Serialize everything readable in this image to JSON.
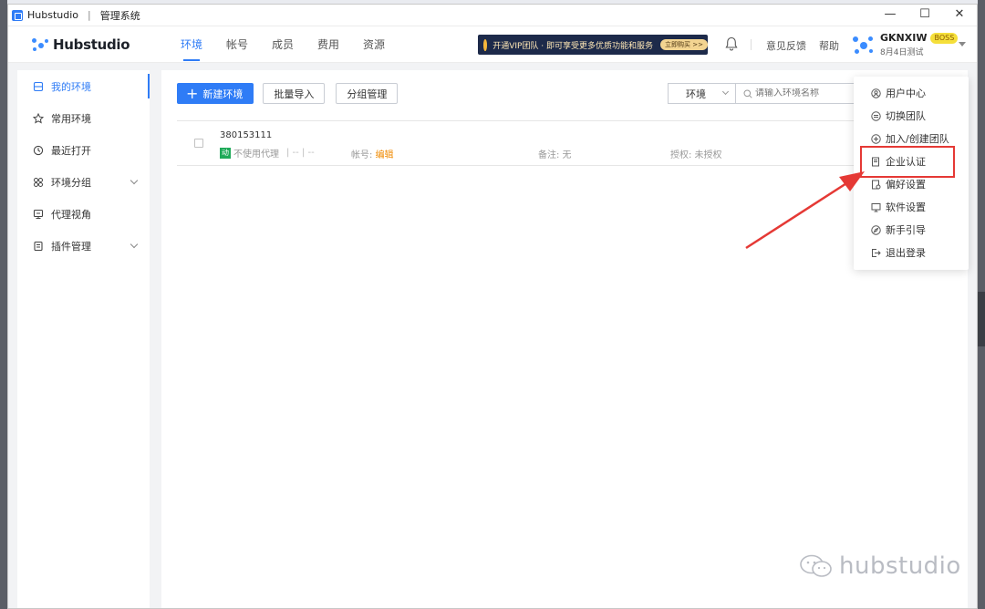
{
  "window": {
    "app_name": "Hubstudio",
    "subtitle": "管理系统",
    "controls": {
      "minimize": "—",
      "maximize": "☐",
      "close": "✕"
    }
  },
  "header": {
    "logo_text": "Hubstudio",
    "tabs": [
      {
        "label": "环境",
        "active": true
      },
      {
        "label": "帐号",
        "active": false
      },
      {
        "label": "成员",
        "active": false
      },
      {
        "label": "费用",
        "active": false
      },
      {
        "label": "资源",
        "active": false
      }
    ],
    "promo": {
      "text": "开通VIP团队 · 即可享受更多优质功能和服务",
      "button": "立即购买 >>"
    },
    "feedback": "意见反馈",
    "help": "帮助",
    "user": {
      "name": "GKNXIW",
      "badge": "BOSS",
      "team": "8月4日测试"
    }
  },
  "sidebar": {
    "items": [
      {
        "label": "我的环境",
        "icon": "env-icon",
        "active": true,
        "expandable": false
      },
      {
        "label": "常用环境",
        "icon": "star-icon",
        "active": false,
        "expandable": false
      },
      {
        "label": "最近打开",
        "icon": "clock-icon",
        "active": false,
        "expandable": false
      },
      {
        "label": "环境分组",
        "icon": "group-icon",
        "active": false,
        "expandable": true
      },
      {
        "label": "代理视角",
        "icon": "proxy-icon",
        "active": false,
        "expandable": false
      },
      {
        "label": "插件管理",
        "icon": "plugin-icon",
        "active": false,
        "expandable": true
      }
    ]
  },
  "toolbar": {
    "new_env": "新建环境",
    "batch_import": "批量导入",
    "group_manage": "分组管理"
  },
  "filter": {
    "select_value": "环境",
    "search_placeholder": "请输入环境名称"
  },
  "environments": [
    {
      "id": "380153111",
      "proxy_tag": "动",
      "proxy_text": "不使用代理",
      "proxy_extra": "| -- | --",
      "account_label": "帐号:",
      "account_action": "编辑",
      "note": "备注: 无",
      "auth": "授权: 未授权"
    }
  ],
  "user_menu": {
    "items": [
      {
        "label": "用户中心",
        "icon": "user-center-icon"
      },
      {
        "label": "切换团队",
        "icon": "switch-team-icon"
      },
      {
        "label": "加入/创建团队",
        "icon": "add-team-icon"
      },
      {
        "label": "企业认证",
        "icon": "enterprise-cert-icon",
        "highlighted": true
      },
      {
        "label": "偏好设置",
        "icon": "preference-icon"
      },
      {
        "label": "软件设置",
        "icon": "software-settings-icon"
      },
      {
        "label": "新手引导",
        "icon": "guide-icon"
      },
      {
        "label": "退出登录",
        "icon": "logout-icon"
      }
    ]
  },
  "annotation": {
    "highlight_color": "#e53935",
    "arrow_color": "#e53935"
  },
  "watermark": "hubstudio",
  "colors": {
    "accent": "#2f7cf6",
    "edit": "#f08a00",
    "proxy_tag": "#1faa59",
    "badge": "#f5df3a"
  }
}
